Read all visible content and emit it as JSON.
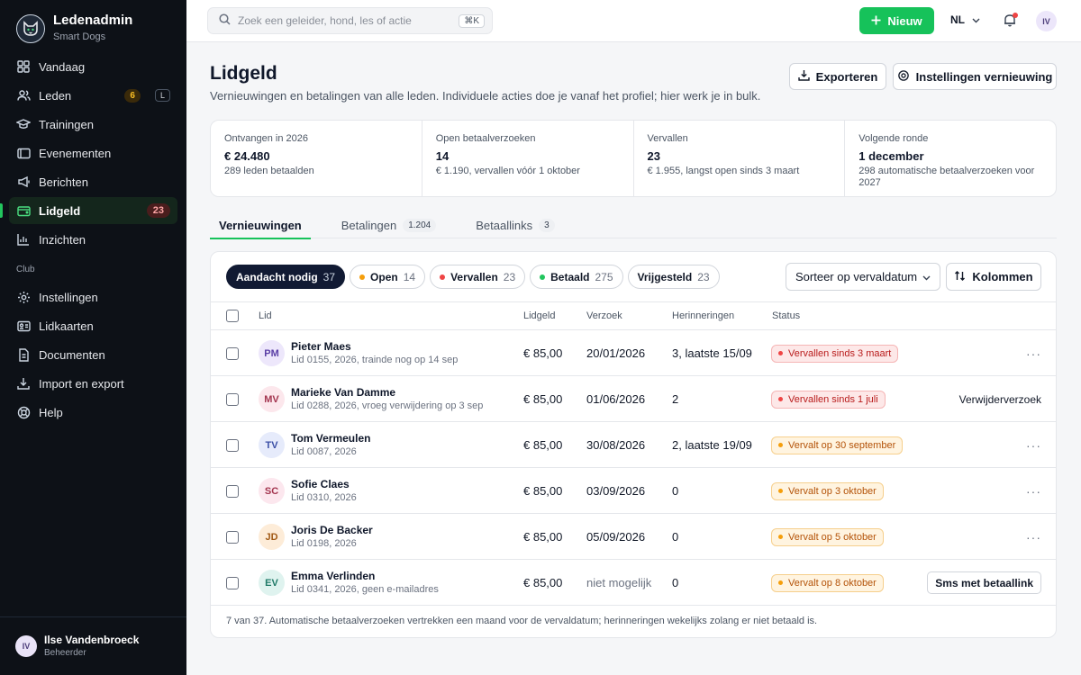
{
  "brand": {
    "title": "Ledenadmin",
    "subtitle": "Smart Dogs"
  },
  "nav": {
    "items": [
      {
        "label": "Vandaag",
        "icon": "grid-icon"
      },
      {
        "label": "Leden",
        "icon": "users-icon",
        "badge": "6",
        "shortcut": "L"
      },
      {
        "label": "Trainingen",
        "icon": "graduation-cap-icon"
      },
      {
        "label": "Evenementen",
        "icon": "ticket-icon"
      },
      {
        "label": "Berichten",
        "icon": "megaphone-icon"
      },
      {
        "label": "Lidgeld",
        "icon": "wallet-icon",
        "badge": "23",
        "active": true
      },
      {
        "label": "Inzichten",
        "icon": "bar-chart-icon"
      }
    ],
    "section_label": "Club",
    "club_items": [
      {
        "label": "Instellingen",
        "icon": "gear-icon"
      },
      {
        "label": "Lidkaarten",
        "icon": "id-card-icon"
      },
      {
        "label": "Documenten",
        "icon": "document-icon"
      },
      {
        "label": "Import en export",
        "icon": "download-icon"
      },
      {
        "label": "Help",
        "icon": "lifebuoy-icon"
      }
    ]
  },
  "user": {
    "initials": "IV",
    "name": "Ilse Vandenbroeck",
    "role": "Beheerder"
  },
  "topbar": {
    "search_placeholder": "Zoek een geleider, hond, les of actie",
    "search_shortcut": "⌘K",
    "new_label": "Nieuw",
    "language": "NL",
    "avatar_initials": "IV"
  },
  "page": {
    "title": "Lidgeld",
    "subtitle": "Vernieuwingen en betalingen van alle leden. Individuele acties doe je vanaf het profiel; hier werk je in bulk.",
    "export_label": "Exporteren",
    "settings_label": "Instellingen vernieuwing"
  },
  "stats": [
    {
      "label": "Ontvangen in 2026",
      "value": "€ 24.480",
      "note": "289 leden betaalden"
    },
    {
      "label": "Open betaalverzoeken",
      "value": "14",
      "note": "€ 1.190, vervallen vóór 1 oktober"
    },
    {
      "label": "Vervallen",
      "value": "23",
      "note": "€ 1.955, langst open sinds 3 maart"
    },
    {
      "label": "Volgende ronde",
      "value": "1 december",
      "note": "298 automatische betaalverzoeken voor 2027"
    }
  ],
  "tabs": [
    {
      "label": "Vernieuwingen",
      "count": "",
      "active": true
    },
    {
      "label": "Betalingen",
      "count": "1.204"
    },
    {
      "label": "Betaallinks",
      "count": "3"
    }
  ],
  "filters": [
    {
      "label": "Aandacht nodig",
      "count": "37",
      "active": true,
      "dot": ""
    },
    {
      "label": "Open",
      "count": "14",
      "dot": "#f59e0b"
    },
    {
      "label": "Vervallen",
      "count": "23",
      "dot": "#ef4444"
    },
    {
      "label": "Betaald",
      "count": "275",
      "dot": "#22c55e"
    },
    {
      "label": "Vrijgesteld",
      "count": "23",
      "dot": ""
    }
  ],
  "sort_label": "Sorteer op vervaldatum",
  "columns_label": "Kolommen",
  "table": {
    "headers": {
      "member": "Lid",
      "fee": "Lidgeld",
      "request": "Verzoek",
      "reminders": "Herinneringen",
      "status": "Status"
    },
    "rows": [
      {
        "initials": "PM",
        "name": "Pieter Maes",
        "meta": "Lid 0155, 2026, trainde nog op 14 sep",
        "fee": "€ 85,00",
        "request": "20/01/2026",
        "reminders": "3, laatste 15/09",
        "status": "Vervallen sinds 3 maart",
        "status_kind": "red",
        "action": "…",
        "action_kind": "more",
        "avatar_bg": "#ede7fb",
        "avatar_fg": "#5b3fa6"
      },
      {
        "initials": "MV",
        "name": "Marieke Van Damme",
        "meta": "Lid 0288, 2026, vroeg verwijdering op 3 sep",
        "fee": "€ 85,00",
        "request": "01/06/2026",
        "reminders": "2",
        "status": "Vervallen sinds 1 juli",
        "status_kind": "red",
        "action": "Verwijderverzoek",
        "action_kind": "text",
        "avatar_bg": "#fce7ec",
        "avatar_fg": "#a3354f"
      },
      {
        "initials": "TV",
        "name": "Tom Vermeulen",
        "meta": "Lid 0087, 2026",
        "fee": "€ 85,00",
        "request": "30/08/2026",
        "reminders": "2, laatste 19/09",
        "status": "Vervalt op 30 september",
        "status_kind": "amber",
        "action": "…",
        "action_kind": "more",
        "avatar_bg": "#e6ebfb",
        "avatar_fg": "#3b4fa6"
      },
      {
        "initials": "SC",
        "name": "Sofie Claes",
        "meta": "Lid 0310, 2026",
        "fee": "€ 85,00",
        "request": "03/09/2026",
        "reminders": "0",
        "status": "Vervalt op 3 oktober",
        "status_kind": "amber",
        "action": "…",
        "action_kind": "more",
        "avatar_bg": "#fce7ee",
        "avatar_fg": "#a3354f"
      },
      {
        "initials": "JD",
        "name": "Joris De Backer",
        "meta": "Lid 0198, 2026",
        "fee": "€ 85,00",
        "request": "05/09/2026",
        "reminders": "0",
        "status": "Vervalt op 5 oktober",
        "status_kind": "amber",
        "action": "…",
        "action_kind": "more",
        "avatar_bg": "#fdecd8",
        "avatar_fg": "#a15a16"
      },
      {
        "initials": "EV",
        "name": "Emma Verlinden",
        "meta": "Lid 0341, 2026, geen e-mailadres",
        "fee": "€ 85,00",
        "request": "niet mogelijk",
        "reminders": "0",
        "status": "Vervalt op 8 oktober",
        "status_kind": "amber",
        "action": "Sms met betaallink",
        "action_kind": "button",
        "avatar_bg": "#dff3ef",
        "avatar_fg": "#1f7a68"
      }
    ]
  },
  "footnote": "7 van 37. Automatische betaalverzoeken vertrekken een maand voor de vervaldatum; herinneringen wekelijks zolang er niet betaald is."
}
